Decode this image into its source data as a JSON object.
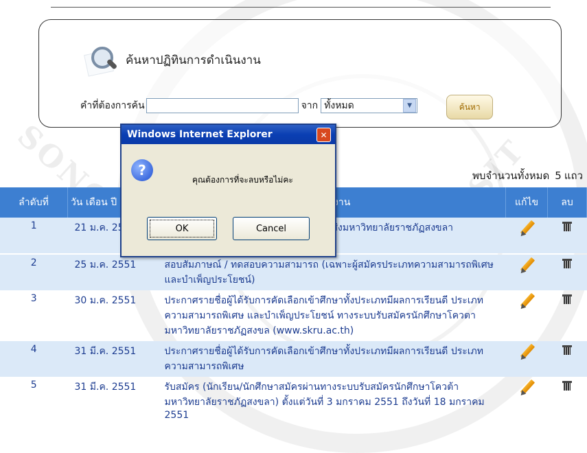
{
  "search": {
    "title": "ค้นหาปฏิทินการดำเนินงาน",
    "keyword_label": "คำที่ต้องการค้น",
    "keyword_value": "",
    "from_label": "จาก",
    "scope_value": "ทั้งหมด",
    "button_label": "ค้นหา"
  },
  "results": {
    "count_label": "พบจำนวนทั้งหมด",
    "count": "5",
    "count_unit": "แถว",
    "headers": {
      "no": "ลำดับที่",
      "date": "วัน เดือน ปี",
      "task": "งาน",
      "edit": "แก้ไข",
      "delete": "ลบ"
    },
    "rows": [
      {
        "no": "1",
        "date": "21 ม.ค. 2551",
        "task": "ส่งมหาวิทยาลัยราชภัฏสงขลา"
      },
      {
        "no": "2",
        "date": "25 ม.ค. 2551",
        "task": "สอบสัมภาษณ์ / ทดสอบความสามารถ (เฉพาะผู้สมัครประเภทความสามารถพิเศษ และบำเพ็ญประโยชน์)"
      },
      {
        "no": "3",
        "date": "30 ม.ค. 2551",
        "task": "ประกาศรายชื่อผู้ได้รับการคัดเลือกเข้าศึกษาทั้งประเภทมีผลการเรียนดี ประเภทความสามารถพิเศษ และบำเพ็ญประโยชน์ ทางระบบรับสมัครนักศึกษาโควตา มหาวิทยาลัยราชภัฏสงขล (www.skru.ac.th)"
      },
      {
        "no": "4",
        "date": "31 มี.ค. 2551",
        "task": "ประกาศรายชื่อผู้ได้รับการคัดเลือกเข้าศึกษาทั้งประเภทมีผลการเรียนดี ประเภทความสามารถพิเศษ"
      },
      {
        "no": "5",
        "date": "31 มี.ค. 2551",
        "task": "รับสมัคร (นักเรียน/นักศึกษาสมัครผ่านทางระบบรับสมัครนักศึกษาโควต้า มหาวิทยาลัยราชภัฏสงขลา) ตั้งแต่วันที่ 3 มกราคม 2551 ถึงวันที่ 18 มกราคม 2551"
      }
    ]
  },
  "dialog": {
    "title": "Windows Internet Explorer",
    "message": "คุณต้องการที่จะลบหรือไม่คะ",
    "ok_label": "OK",
    "cancel_label": "Cancel",
    "close_glyph": "✕",
    "icon": "question-icon"
  },
  "watermark": {
    "text": "SONGKHLA RAJABHAT UNIVERSITY"
  },
  "colors": {
    "header_bg": "#3d7fd1",
    "row_alt_bg": "#dbe9f8",
    "link_text": "#1a3a8f",
    "dialog_titlebar": "#0a3fb3"
  }
}
